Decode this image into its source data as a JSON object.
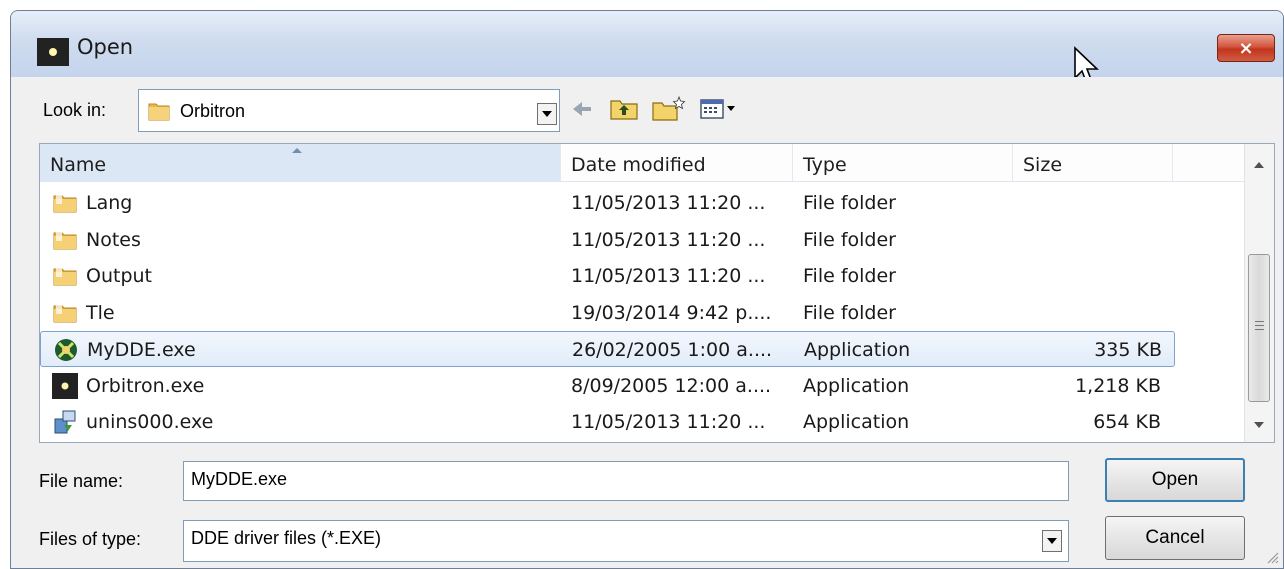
{
  "window": {
    "title": "Open",
    "close_label": "×"
  },
  "toolbar": {
    "lookin_label": "Look in:",
    "lookin_value": "Orbitron",
    "icons": [
      "back-arrow-icon",
      "up-folder-icon",
      "new-folder-icon",
      "view-menu-icon"
    ]
  },
  "filelist": {
    "columns": {
      "name": "Name",
      "date": "Date modified",
      "type": "Type",
      "size": "Size"
    },
    "rows": [
      {
        "name": "Lang",
        "date": "11/05/2013 11:20 ...",
        "type": "File folder",
        "size": "",
        "icon": "folder-icon"
      },
      {
        "name": "Notes",
        "date": "11/05/2013 11:20 ...",
        "type": "File folder",
        "size": "",
        "icon": "folder-icon"
      },
      {
        "name": "Output",
        "date": "11/05/2013 11:20 ...",
        "type": "File folder",
        "size": "",
        "icon": "folder-icon"
      },
      {
        "name": "Tle",
        "date": "19/03/2014 9:42 p....",
        "type": "File folder",
        "size": "",
        "icon": "folder-icon"
      },
      {
        "name": "MyDDE.exe",
        "date": "26/02/2005 1:00 a....",
        "type": "Application",
        "size": "335 KB",
        "icon": "mydde-app-icon",
        "selected": true
      },
      {
        "name": "Orbitron.exe",
        "date": "8/09/2005 12:00 a....",
        "type": "Application",
        "size": "1,218 KB",
        "icon": "orbitron-app-icon"
      },
      {
        "name": "unins000.exe",
        "date": "11/05/2013 11:20 ...",
        "type": "Application",
        "size": "654 KB",
        "icon": "uninstaller-icon"
      }
    ]
  },
  "bottom": {
    "filename_label": "File name:",
    "filename_value": "MyDDE.exe",
    "filetype_label": "Files of type:",
    "filetype_value": "DDE driver files (*.EXE)",
    "open_label": "Open",
    "cancel_label": "Cancel"
  },
  "colors": {
    "selection_border": "#7da2ce",
    "title_gradient": "#c4d4ec",
    "close_red": "#c2351d"
  }
}
